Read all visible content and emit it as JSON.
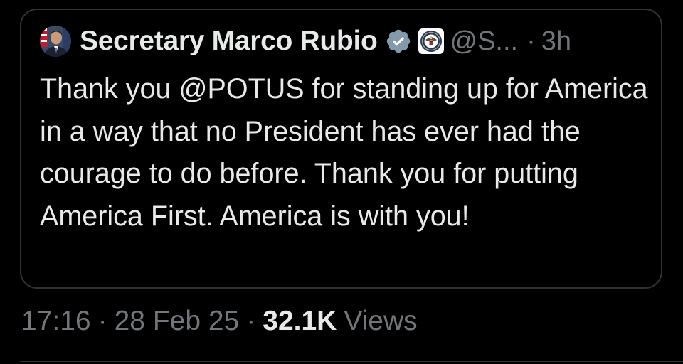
{
  "quote": {
    "author_name": "Secretary Marco Rubio",
    "handle": "@S...",
    "separator": "·",
    "time_ago": "3h",
    "text_parts": {
      "before_mention": "Thank you ",
      "mention": "@POTUS",
      "after_mention": " for standing up for America in a way that no President has ever had the courage to do before. Thank you for putting America First. America is with you!"
    },
    "verified_badge_color": "#829aab",
    "avatar_icon": "portrait-avatar",
    "affiliate_icon": "state-department-seal-icon"
  },
  "meta": {
    "time": "17:16",
    "dot1": "·",
    "date": "28 Feb 25",
    "dot2": "·",
    "views_count": "32.1K",
    "views_label": "Views"
  },
  "colors": {
    "background": "#000000",
    "text_primary": "#e7e9ea",
    "text_secondary": "#71767b",
    "border": "#2f3336"
  }
}
